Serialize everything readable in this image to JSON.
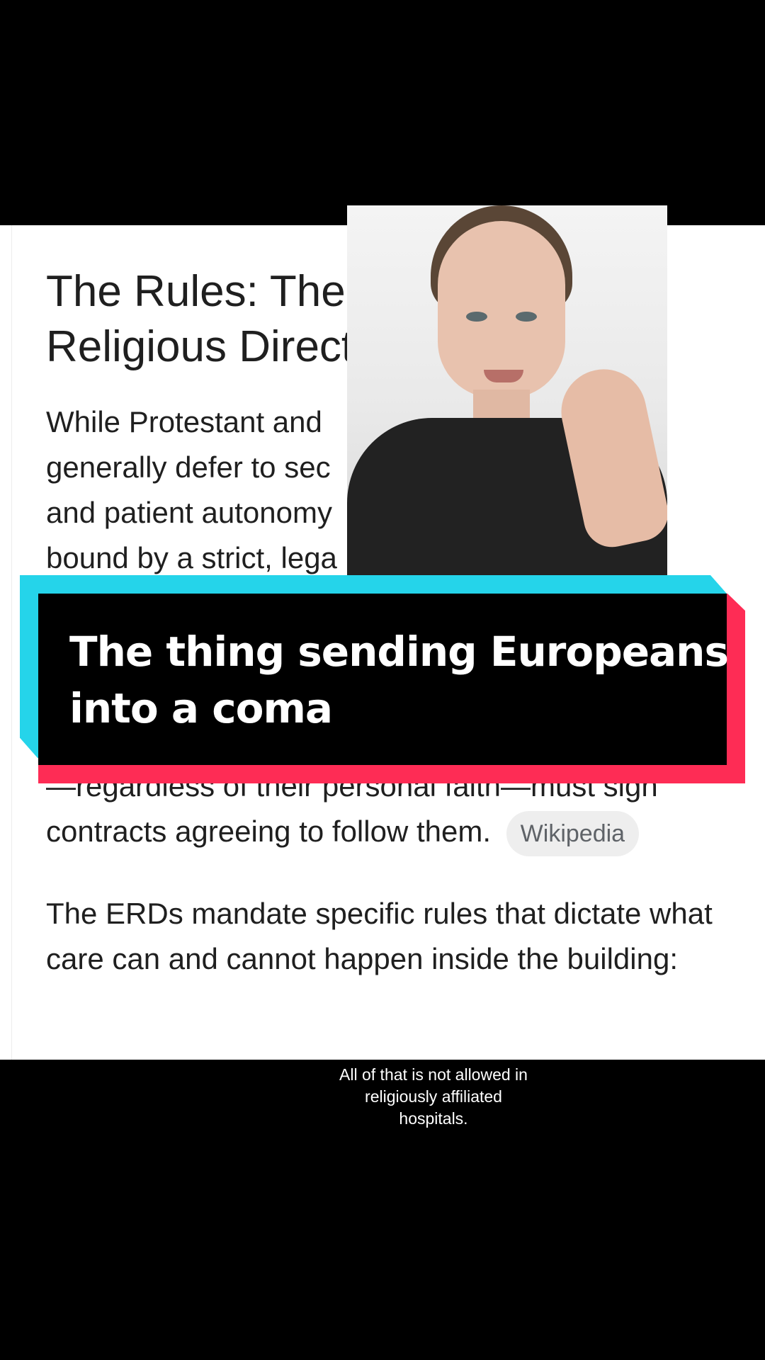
{
  "document": {
    "heading": "The Rules: The Ethi… Religious Directives…s)",
    "heading_line1": "The Rules: The Ethi",
    "heading_line2": "Religious Directive",
    "paragraph1_lines": [
      "While Protestant and",
      "generally defer to sec",
      "and patient autonomy",
      "bound by a strict, lega"
    ],
    "paragraph2_line1": "—regardless of their personal faith—must sign",
    "paragraph2_line2": "contracts agreeing to follow them.",
    "source_chip": "Wikipedia",
    "paragraph3": "The ERDs mandate specific rules that dictate what care can and cannot happen inside the building:"
  },
  "banner": {
    "line1": "The thing sending Europeans",
    "line2": "into a coma"
  },
  "subtitle": {
    "line1": "All of that is not allowed in",
    "line2": "religiously affiliated",
    "line3": "hospitals."
  },
  "colors": {
    "banner_cyan": "#25d4ea",
    "banner_red": "#fe2c55",
    "banner_black": "#000000",
    "doc_background": "#ffffff",
    "chip_background": "#eeeeee"
  }
}
